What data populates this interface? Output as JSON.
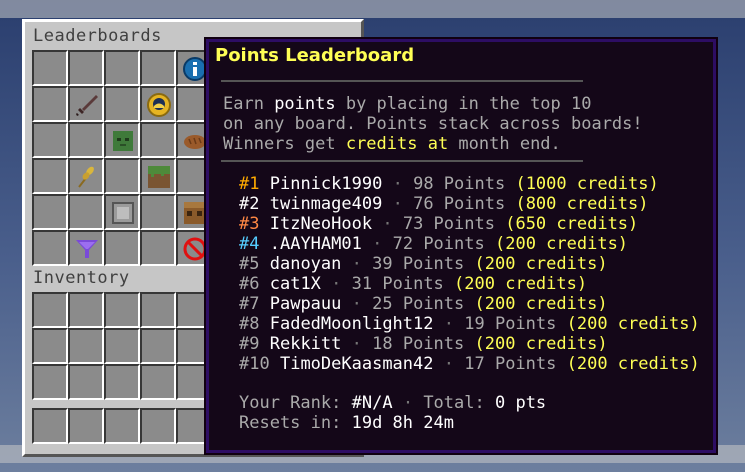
{
  "chest": {
    "title": "Leaderboards",
    "inventory_title": "Inventory"
  },
  "tooltip": {
    "title": "Points Leaderboard",
    "desc1_a": "Earn ",
    "desc1_b": "points",
    "desc1_c": " by placing in the top 10",
    "desc2": "on any board. Points stack across boards!",
    "desc3_a": "Winners get ",
    "desc3_b": "credits at",
    "desc3_c": " month end.",
    "entries": [
      {
        "rank": "#1",
        "name": "Pinnick1990",
        "points": "98 Points",
        "credits": "(1000 credits)"
      },
      {
        "rank": "#2",
        "name": "twinmage409",
        "points": "76 Points",
        "credits": "(800 credits)"
      },
      {
        "rank": "#3",
        "name": "ItzNeoHook",
        "points": "73 Points",
        "credits": "(650 credits)"
      },
      {
        "rank": "#4",
        "name": ".AAYHAM01",
        "points": "72 Points",
        "credits": "(200 credits)"
      },
      {
        "rank": "#5",
        "name": "danoyan",
        "points": "39 Points",
        "credits": "(200 credits)"
      },
      {
        "rank": "#6",
        "name": "cat1X",
        "points": "31 Points",
        "credits": "(200 credits)"
      },
      {
        "rank": "#7",
        "name": "Pawpauu",
        "points": "25 Points",
        "credits": "(200 credits)"
      },
      {
        "rank": "#8",
        "name": "FadedMoonlight12",
        "points": "19 Points",
        "credits": "(200 credits)"
      },
      {
        "rank": "#9",
        "name": "Rekkitt",
        "points": "18 Points",
        "credits": "(200 credits)"
      },
      {
        "rank": "#10",
        "name": "TimoDeKaasman42",
        "points": "17 Points",
        "credits": "(200 credits)"
      }
    ],
    "separator": "·",
    "your_rank_label": "Your Rank:",
    "your_rank_value": "#N/A",
    "total_label": "Total:",
    "total_value": "0 pts",
    "resets_label": "Resets in:",
    "resets_value": "19d 8h 24m"
  },
  "icons": [
    "sword-icon",
    "clock-icon",
    "info-icon",
    "zombie-head-icon",
    "bread-icon",
    "wheat-icon",
    "grass-block-icon",
    "stone-block-icon",
    "crafting-table-icon",
    "funnel-icon",
    "barrier-icon"
  ]
}
